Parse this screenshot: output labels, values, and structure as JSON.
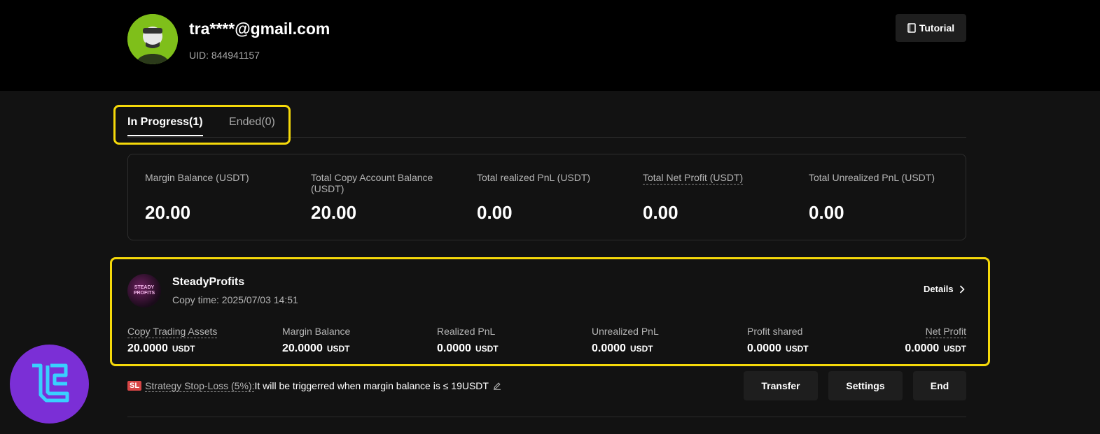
{
  "profile": {
    "email": "tra****@gmail.com",
    "uid": "UID: 844941157",
    "tutorial_label": "Tutorial"
  },
  "tabs": [
    {
      "label": "In Progress(1)",
      "active": true
    },
    {
      "label": "Ended(0)",
      "active": false
    }
  ],
  "summary": [
    {
      "label": "Margin Balance (USDT)",
      "value": "20.00"
    },
    {
      "label": "Total Copy Account Balance (USDT)",
      "value": "20.00"
    },
    {
      "label": "Total realized PnL (USDT)",
      "value": "0.00"
    },
    {
      "label": "Total Net Profit (USDT)",
      "value": "0.00"
    },
    {
      "label": "Total Unrealized PnL (USDT)",
      "value": "0.00"
    }
  ],
  "strategy": {
    "logo_text": "STEADY PROFITS",
    "name": "SteadyProfits",
    "copy_time": "Copy time: 2025/07/03 14:51",
    "details_label": "Details",
    "metrics": [
      {
        "label": "Copy Trading Assets",
        "value": "20.0000",
        "unit": "USDT"
      },
      {
        "label": "Margin Balance",
        "value": "20.0000",
        "unit": "USDT"
      },
      {
        "label": "Realized PnL",
        "value": "0.0000",
        "unit": "USDT"
      },
      {
        "label": "Unrealized PnL",
        "value": "0.0000",
        "unit": "USDT"
      },
      {
        "label": "Profit shared",
        "value": "0.0000",
        "unit": "USDT"
      },
      {
        "label": "Net Profit",
        "value": "0.0000",
        "unit": "USDT"
      }
    ]
  },
  "stop_loss": {
    "badge": "SL",
    "link": "Strategy Stop-Loss (5%):",
    "text": "It will be triggerred when margin balance is ≤ 19USDT"
  },
  "actions": {
    "transfer": "Transfer",
    "settings": "Settings",
    "end": "End"
  },
  "colors": {
    "highlight": "#f5d90a",
    "page_bg": "#121212",
    "header_bg": "#000000",
    "avatar_bg": "#7fbf1a",
    "sl_badge": "#d64545",
    "watermark": "#7b2fd6"
  }
}
